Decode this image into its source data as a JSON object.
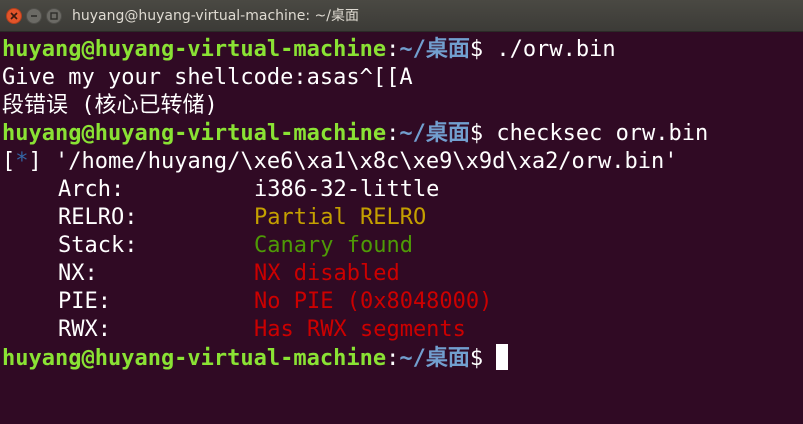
{
  "window": {
    "title": "huyang@huyang-virtual-machine: ~/桌面"
  },
  "colors": {
    "background": "#300a24",
    "prompt_user": "#8ae234",
    "prompt_path": "#729fcf",
    "text": "#ffffff",
    "partial": "#c4a000",
    "canary": "#4e9a06",
    "red": "#cc0000"
  },
  "prompt": {
    "user_host": "huyang@huyang-virtual-machine",
    "colon": ":",
    "path": "~/桌面",
    "dollar": "$ "
  },
  "lines": {
    "cmd1": "./orw.bin",
    "out1": "Give my your shellcode:asas^[[A",
    "out2": "段错误 (核心已转储)",
    "cmd2": "checksec orw.bin",
    "info_open": "[",
    "info_star": "*",
    "info_close": "]",
    "info_path": " '/home/huyang/\\xe6\\xa1\\x8c\\xe9\\x9d\\xa2/orw.bin'"
  },
  "checksec": [
    {
      "label": "Arch:",
      "value": "i386-32-little",
      "color": "#ffffff"
    },
    {
      "label": "RELRO:",
      "value": "Partial RELRO",
      "color": "#c4a000"
    },
    {
      "label": "Stack:",
      "value": "Canary found",
      "color": "#4e9a06"
    },
    {
      "label": "NX:",
      "value": "NX disabled",
      "color": "#cc0000"
    },
    {
      "label": "PIE:",
      "value": "No PIE (0x8048000)",
      "color": "#cc0000"
    },
    {
      "label": "RWX:",
      "value": "Has RWX segments",
      "color": "#cc0000"
    }
  ],
  "icons": {
    "close": "close-icon",
    "minimize": "minimize-icon",
    "maximize": "maximize-icon"
  }
}
